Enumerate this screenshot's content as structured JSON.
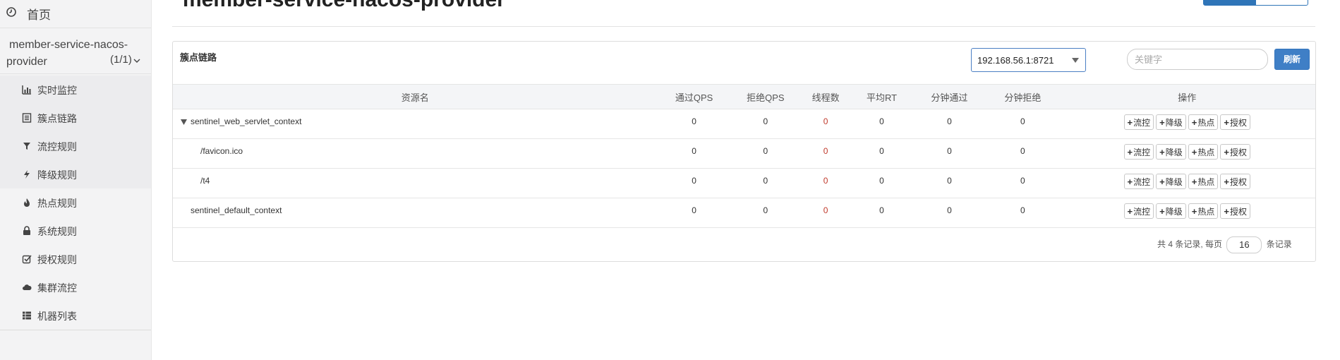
{
  "sidebar": {
    "home_label": "首页",
    "app_name_line1": "member-service-nacos-",
    "app_name_line2": "provider",
    "app_count": "(1/1)",
    "items": [
      {
        "label": "实时监控",
        "icon": "bar-chart-icon"
      },
      {
        "label": "簇点链路",
        "icon": "list-icon"
      },
      {
        "label": "流控规则",
        "icon": "filter-icon"
      },
      {
        "label": "降级规则",
        "icon": "bolt-icon"
      },
      {
        "label": "热点规则",
        "icon": "fire-icon"
      },
      {
        "label": "系统规则",
        "icon": "lock-icon"
      },
      {
        "label": "授权规则",
        "icon": "check-square-icon"
      },
      {
        "label": "集群流控",
        "icon": "cloud-icon"
      },
      {
        "label": "机器列表",
        "icon": "th-list-icon"
      }
    ]
  },
  "header": {
    "title": "member-service-nacos-provider"
  },
  "panel": {
    "title": "簇点链路",
    "machine_value": "192.168.56.1:8721",
    "keyword_placeholder": "关键字",
    "refresh_label": "刷新"
  },
  "table": {
    "columns": [
      "资源名",
      "通过QPS",
      "拒绝QPS",
      "线程数",
      "平均RT",
      "分钟通过",
      "分钟拒绝",
      "操作"
    ],
    "rows": [
      {
        "name": "sentinel_web_servlet_context",
        "pass_qps": "0",
        "block_qps": "0",
        "threads": "0",
        "avg_rt": "0",
        "min_pass": "0",
        "min_block": "0"
      },
      {
        "name": "/favicon.ico",
        "pass_qps": "0",
        "block_qps": "0",
        "threads": "0",
        "avg_rt": "0",
        "min_pass": "0",
        "min_block": "0"
      },
      {
        "name": "/t4",
        "pass_qps": "0",
        "block_qps": "0",
        "threads": "0",
        "avg_rt": "0",
        "min_pass": "0",
        "min_block": "0"
      },
      {
        "name": "sentinel_default_context",
        "pass_qps": "0",
        "block_qps": "0",
        "threads": "0",
        "avg_rt": "0",
        "min_pass": "0",
        "min_block": "0"
      }
    ],
    "op_labels": [
      "流控",
      "降级",
      "热点",
      "授权"
    ]
  },
  "pager": {
    "prefix": "共 4 条记录, 每页",
    "page_size": "16",
    "suffix": "条记录"
  }
}
